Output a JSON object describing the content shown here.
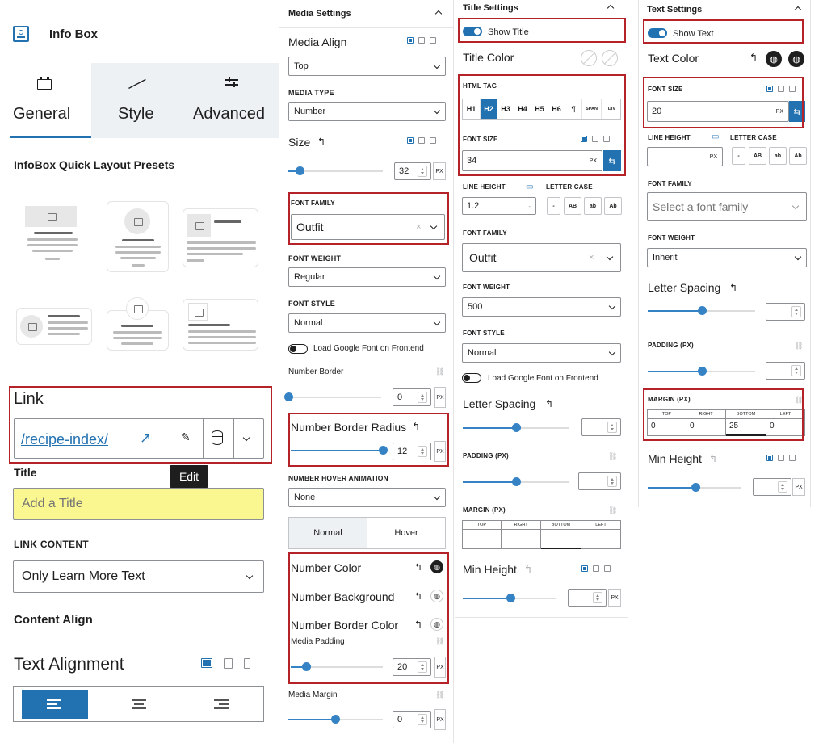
{
  "general_panel": {
    "title": "Info Box",
    "tabs": [
      {
        "label": "General",
        "icon": "briefcase-icon",
        "active": true
      },
      {
        "label": "Style",
        "icon": "brush-icon",
        "active": false
      },
      {
        "label": "Advanced",
        "icon": "sliders-icon",
        "active": false
      }
    ],
    "presets_heading": "InfoBox Quick Layout Presets",
    "link_label": "Link",
    "link_value": "/recipe-index/",
    "edit_tooltip": "Edit",
    "title_label": "Title",
    "title_placeholder": "Add a Title",
    "link_content_label": "LINK CONTENT",
    "link_content_value": "Only Learn More Text",
    "content_align_label": "Content Align",
    "text_alignment_label": "Text Alignment"
  },
  "media_panel": {
    "section_title": "Media Settings",
    "media_align_label": "Media Align",
    "media_align_value": "Top",
    "media_type_label": "MEDIA TYPE",
    "media_type_value": "Number",
    "size_label": "Size",
    "size_value": "32",
    "size_percent": 12,
    "unit_px": "PX",
    "font_family_label": "FONT FAMILY",
    "font_family_value": "Outfit",
    "font_weight_label": "FONT WEIGHT",
    "font_weight_value": "Regular",
    "font_style_label": "FONT STYLE",
    "font_style_value": "Normal",
    "load_google_font_label": "Load Google Font on Frontend",
    "number_border_label": "Number Border",
    "number_border_value": "0",
    "number_border_radius_label": "Number Border Radius",
    "number_border_radius_value": "12",
    "hover_animation_label": "NUMBER HOVER ANIMATION",
    "hover_animation_value": "None",
    "normal_tab": "Normal",
    "hover_tab": "Hover",
    "number_color_label": "Number Color",
    "number_background_label": "Number Background",
    "number_border_color_label": "Number Border Color",
    "media_padding_label": "Media Padding",
    "media_padding_value": "20",
    "media_margin_label": "Media Margin",
    "media_margin_value": "0"
  },
  "title_panel": {
    "section_title": "Title Settings",
    "show_title_label": "Show Title",
    "title_color_label": "Title Color",
    "html_tag_label": "HTML TAG",
    "html_tags": [
      "H1",
      "H2",
      "H3",
      "H4",
      "H5",
      "H6",
      "¶",
      "SPAN",
      "DIV"
    ],
    "active_tag": "H2",
    "font_size_label": "FONT SIZE",
    "font_size_value": "34",
    "unit_px": "PX",
    "line_height_label": "LINE HEIGHT",
    "line_height_value": "1.2",
    "letter_case_label": "LETTER CASE",
    "letter_case_options": [
      "-",
      "AB",
      "ab",
      "Ab"
    ],
    "font_family_label": "FONT FAMILY",
    "font_family_value": "Outfit",
    "font_weight_label": "FONT WEIGHT",
    "font_weight_value": "500",
    "font_style_label": "FONT STYLE",
    "font_style_value": "Normal",
    "load_google_font_label": "Load Google Font on Frontend",
    "letter_spacing_label": "Letter Spacing",
    "padding_label": "PADDING (PX)",
    "margin_label": "MARGIN (PX)",
    "margin_sides": [
      "TOP",
      "RIGHT",
      "BOTTOM",
      "LEFT"
    ],
    "min_height_label": "Min Height"
  },
  "text_panel": {
    "section_title": "Text Settings",
    "show_text_label": "Show Text",
    "text_color_label": "Text Color",
    "font_size_label": "FONT SIZE",
    "font_size_value": "20",
    "unit_px": "PX",
    "line_height_label": "LINE HEIGHT",
    "letter_case_label": "LETTER CASE",
    "letter_case_options": [
      "-",
      "AB",
      "ab",
      "Ab"
    ],
    "font_family_label": "FONT FAMILY",
    "font_family_placeholder": "Select a font family",
    "font_weight_label": "FONT WEIGHT",
    "font_weight_value": "Inherit",
    "letter_spacing_label": "Letter Spacing",
    "padding_label": "PADDING (PX)",
    "margin_label": "MARGIN (PX)",
    "margin_sides": [
      "TOP",
      "RIGHT",
      "BOTTOM",
      "LEFT"
    ],
    "margin_values": [
      "0",
      "0",
      "25",
      "0"
    ],
    "min_height_label": "Min Height"
  },
  "colors": {
    "accent": "#2271b1",
    "highlight": "#b52227",
    "title_input_bg": "#fbf790"
  }
}
